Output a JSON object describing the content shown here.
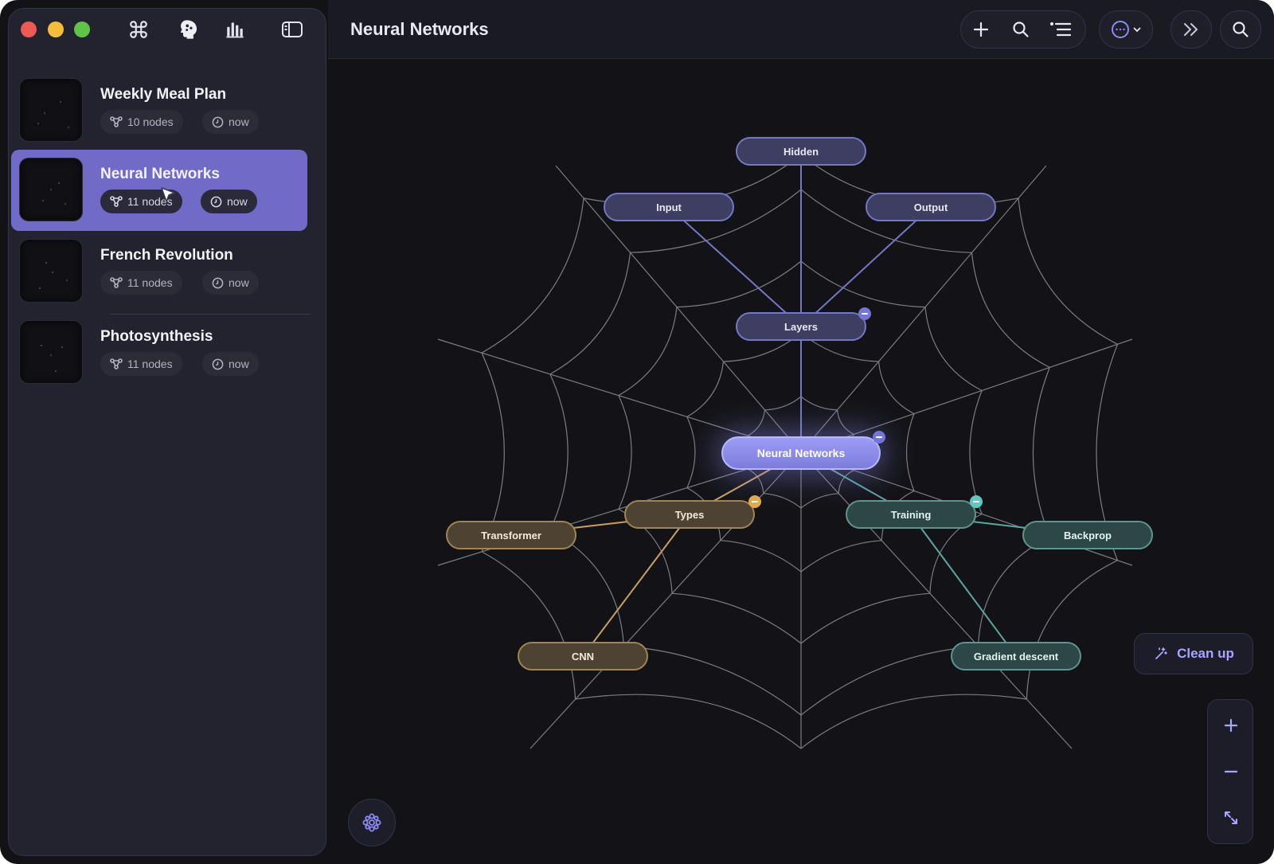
{
  "window": {
    "title": "Neural Networks"
  },
  "sidebar": {
    "toolbar": [
      "command-icon",
      "brain-icon",
      "chart-bars-icon",
      "sidebar-toggle-icon"
    ],
    "items": [
      {
        "title": "Weekly Meal Plan",
        "nodes": "10 nodes",
        "time": "now",
        "selected": false
      },
      {
        "title": "Neural Networks",
        "nodes": "11 nodes",
        "time": "now",
        "selected": true
      },
      {
        "title": "French Revolution",
        "nodes": "11 nodes",
        "time": "now",
        "selected": false
      },
      {
        "title": "Photosynthesis",
        "nodes": "11 nodes",
        "time": "now",
        "selected": false
      }
    ]
  },
  "toolbar": {
    "group1": [
      "plus-icon",
      "search-icon",
      "outline-list-icon"
    ],
    "more": "more-menu-icon",
    "forward": "double-chevron-right-icon",
    "search": "search-icon"
  },
  "mindmap": {
    "root": "Neural Networks",
    "nodes": {
      "hidden": "Hidden",
      "input": "Input",
      "output": "Output",
      "layers": "Layers",
      "types": "Types",
      "transformer": "Transformer",
      "cnn": "CNN",
      "training": "Training",
      "backprop": "Backprop",
      "gradient": "Gradient descent"
    },
    "colors": {
      "purple": "#7477c4",
      "gold": "#c8a060",
      "teal": "#5aa7a0",
      "web": "#8e8e96"
    }
  },
  "actions": {
    "cleanup": "Clean up"
  },
  "zoom": [
    "zoom-in-icon",
    "zoom-out-icon",
    "fit-screen-icon"
  ]
}
